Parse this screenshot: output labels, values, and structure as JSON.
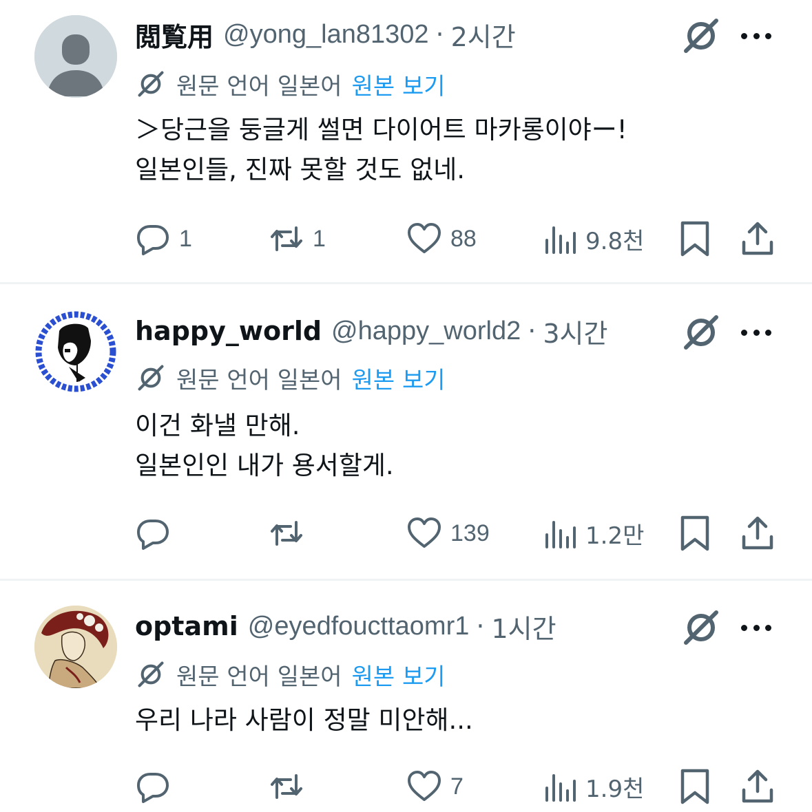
{
  "translate": {
    "lang_text": "원문 언어 일본어",
    "view_original": "원본 보기"
  },
  "tweets": [
    {
      "username": "閲覧用",
      "handle": "@yong_lan81302",
      "dot": "·",
      "time": "2시간",
      "lines": [
        "＞당근을 둥글게 썰면 다이어트 마카롱이야ー!",
        "일본인들, 진짜 못할 것도 없네."
      ],
      "replies": "1",
      "reposts": "1",
      "likes": "88",
      "views": "9.8천"
    },
    {
      "username": "happy_world",
      "handle": "@happy_world2",
      "dot": "·",
      "time": "3시간",
      "lines": [
        "이건 화낼 만해.",
        "일본인인 내가 용서할게."
      ],
      "replies": "",
      "reposts": "",
      "likes": "139",
      "views": "1.2만"
    },
    {
      "username": "optami",
      "handle": "@eyedfoucttaomr1",
      "dot": "·",
      "time": "1시간",
      "lines": [
        "우리 나라 사람이 정말 미안해..."
      ],
      "replies": "",
      "reposts": "",
      "likes": "7",
      "views": "1.9천"
    }
  ],
  "colors": {
    "text": "#0f1419",
    "secondary": "#536471",
    "link": "#1d9bf0",
    "divider": "#eff3f4"
  }
}
